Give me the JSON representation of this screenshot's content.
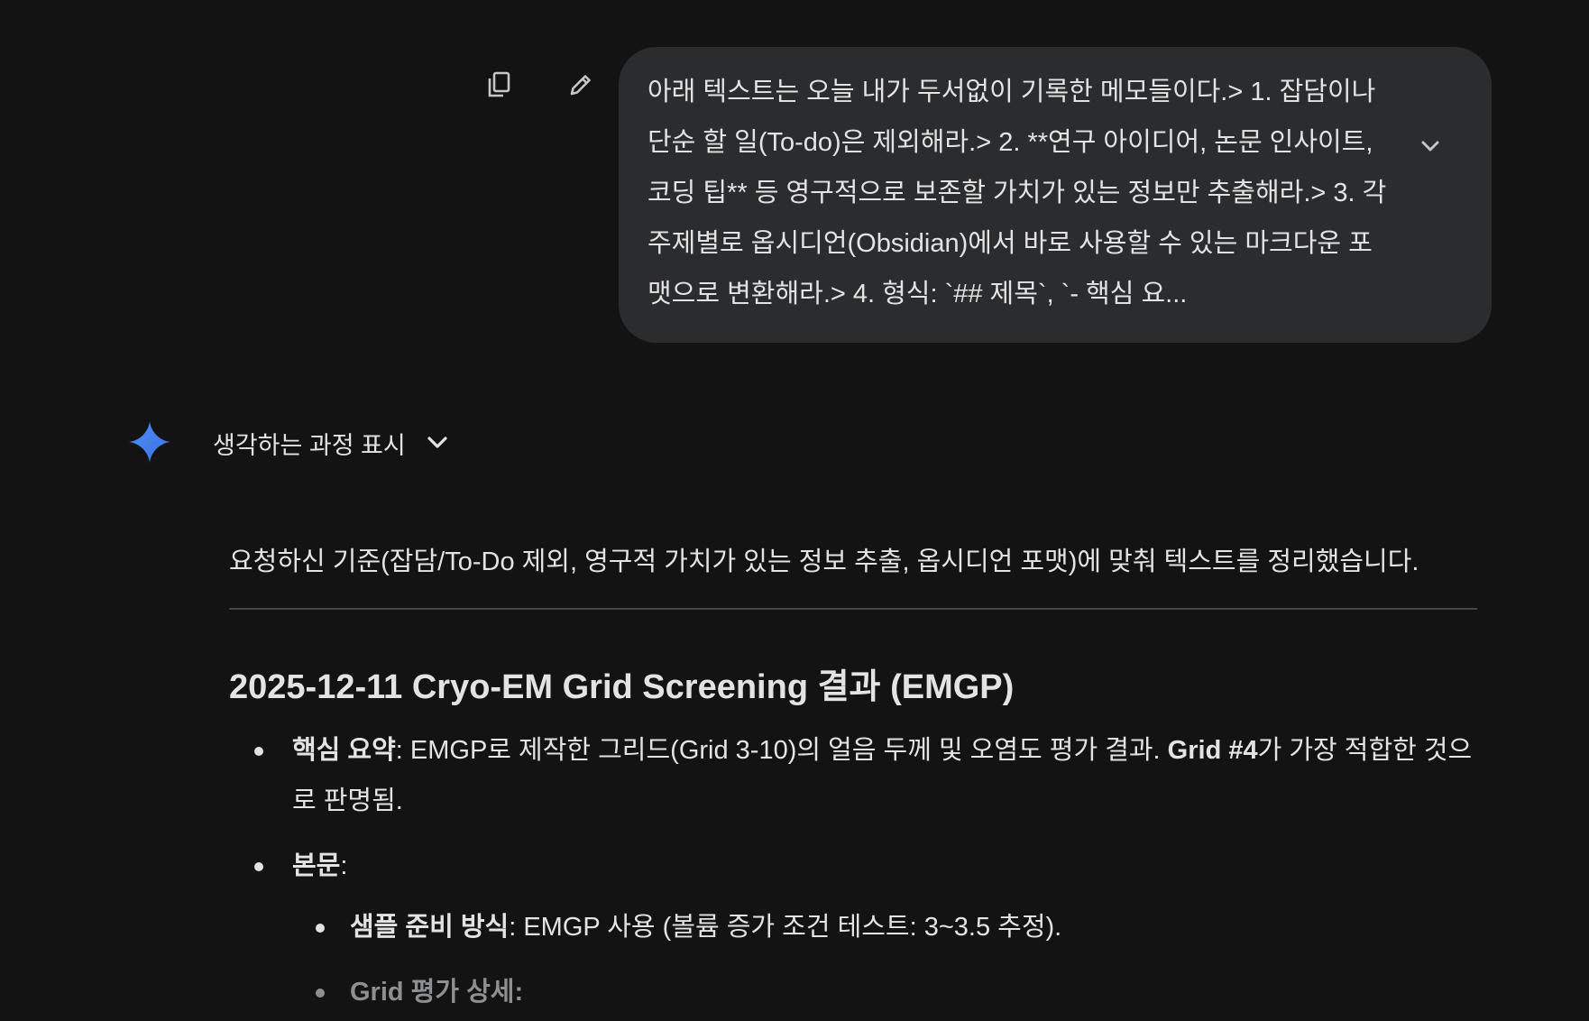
{
  "user_message": {
    "text": "아래 텍스트는 오늘 내가 두서없이 기록한 메모들이다.> 1. 잡담이나 단순 할 일(To-do)은 제외해라.> 2. **연구 아이디어, 논문 인사이트, 코딩 팁** 등 영구적으로 보존할 가치가 있는 정보만 추출해라.> 3. 각 주제별로 옵시디언(Obsidian)에서 바로 사용할 수 있는 마크다운 포맷으로 변환해라.> 4. 형식: `## 제목`, `- 핵심 요..."
  },
  "icons": {
    "copy": "copy-icon",
    "edit": "edit-pencil-icon",
    "expand": "chevron-down-icon",
    "gemini": "gemini-sparkle-icon",
    "thinking_chevron": "chevron-down-icon"
  },
  "colors": {
    "background": "#131314",
    "bubble": "#2b2c2e",
    "text": "#e3e3e3",
    "gemini_blue": "#4285f4"
  },
  "thinking": {
    "label": "생각하는 과정 표시"
  },
  "response": {
    "intro": "요청하신 기준(잡담/To-Do 제외, 영구적 가치가 있는 정보 추출, 옵시디언 포맷)에 맞춰 텍스트를 정리했습니다.",
    "section_title": "2025-12-11 Cryo-EM Grid Screening 결과 (EMGP)",
    "bullets": {
      "summary_label": "핵심 요약",
      "summary_text_1": ": EMGP로 제작한 그리드(Grid 3-10)의 얼음 두께 및 오염도 평가 결과. ",
      "summary_bold": "Grid #4",
      "summary_text_2": "가 가장 적합한 것으로 판명됨.",
      "body_label": "본문",
      "body_colon": ":",
      "sub": {
        "sample_label": "샘플 준비 방식",
        "sample_text": ": EMGP 사용 (볼륨 증가 조건 테스트: 3~3.5 추정).",
        "grid_eval_label": "Grid 평가 상세:"
      }
    }
  }
}
